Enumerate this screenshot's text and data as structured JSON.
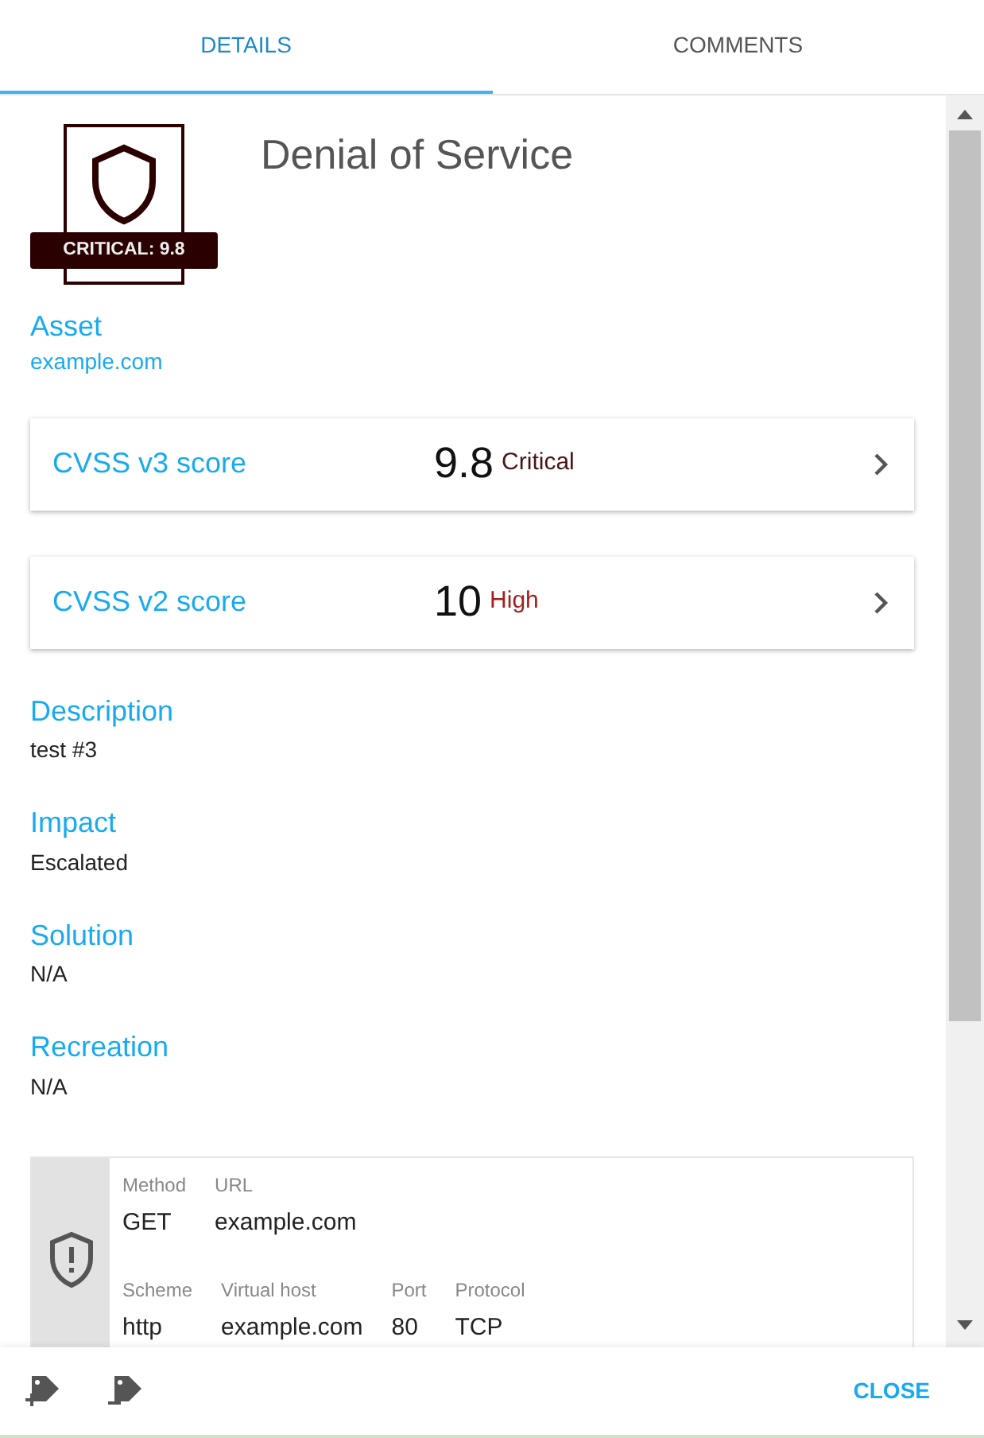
{
  "tabs": [
    {
      "label": "DETAILS",
      "selected": true
    },
    {
      "label": "COMMENTS",
      "selected": false
    }
  ],
  "badge": {
    "label": "CRITICAL: 9.8",
    "color": "#2b0000"
  },
  "title": "Denial of Service",
  "asset": {
    "label": "Asset",
    "value": "example.com"
  },
  "scores": [
    {
      "label": "CVSS v3 score",
      "value": "9.8",
      "severity": "Critical",
      "color": "#4a1414"
    },
    {
      "label": "CVSS v2 score",
      "value": "10",
      "severity": "High",
      "color": "#a31f1f"
    }
  ],
  "sections": [
    {
      "label": "Description",
      "value": "test #3"
    },
    {
      "label": "Impact",
      "value": "Escalated"
    },
    {
      "label": "Solution",
      "value": "N/A"
    },
    {
      "label": "Recreation",
      "value": "N/A"
    }
  ],
  "request": {
    "rows": [
      [
        {
          "label": "Method",
          "value": "GET"
        },
        {
          "label": "URL",
          "value": "example.com"
        }
      ],
      [
        {
          "label": "Scheme",
          "value": "http"
        },
        {
          "label": "Virtual host",
          "value": "example.com"
        },
        {
          "label": "Port",
          "value": "80"
        },
        {
          "label": "Protocol",
          "value": "TCP"
        }
      ]
    ]
  },
  "footer": {
    "close": "CLOSE"
  }
}
